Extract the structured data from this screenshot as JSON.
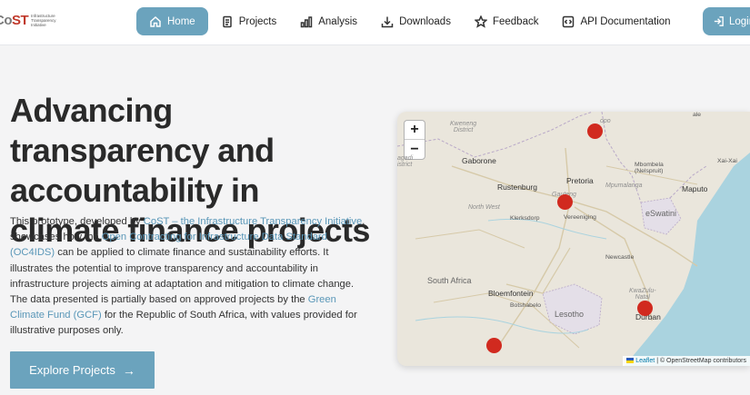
{
  "header": {
    "logo": {
      "main_prefix": "Co",
      "main_accent": "ST",
      "tagline": "Infrastructure Transparency Initiative"
    },
    "nav": [
      {
        "label": "Home",
        "icon": "home-icon",
        "active": true
      },
      {
        "label": "Projects",
        "icon": "document-icon",
        "active": false
      },
      {
        "label": "Analysis",
        "icon": "bar-chart-icon",
        "active": false
      },
      {
        "label": "Downloads",
        "icon": "download-icon",
        "active": false
      },
      {
        "label": "Feedback",
        "icon": "star-icon",
        "active": false
      },
      {
        "label": "API Documentation",
        "icon": "code-icon",
        "active": false
      }
    ],
    "login_label": "Login"
  },
  "hero": {
    "title": "Advancing transparency and accountability in climate finance projects",
    "desc": {
      "p1": "This prototype, developed by ",
      "link1": "CoST – the Infrastructure Transparency Initiative",
      "p2": ", showcases how the ",
      "link2": "Open Contracting for Infrastructure Data Standard (OC4IDS)",
      "p3": " can be applied to climate finance and sustainability efforts. It illustrates the potential to improve transparency and accountability in infrastructure projects aiming at adaptation and mitigation to climate change. The data presented is partially based on approved projects by the ",
      "link3": "Green Climate Fund (GCF)",
      "p4": " for the Republic of South Africa, with values provided for illustrative purposes only."
    },
    "cta_label": "Explore Projects",
    "cta_arrow": "→"
  },
  "map": {
    "zoom_in": "+",
    "zoom_out": "−",
    "places": {
      "kweneng": "Kweneng\nDistrict",
      "gaborone": "Gaborone",
      "pretoria": "Pretoria",
      "rustenburg": "Rustenburg",
      "gauteng": "Gauteng",
      "vereeniging": "Vereeniging",
      "klerksdorp": "Klerksdorp",
      "northwest": "North West",
      "mpumalanga": "Mpumalanga",
      "mbombela": "Mbombela\n(Nelspruit)",
      "maputo": "Maputo",
      "xaixai": "Xai-Xai",
      "eswatini": "eSwatini",
      "newcastle": "Newcastle",
      "southafrica": "South Africa",
      "bloemfontein": "Bloemfontein",
      "botshabelo": "Botshabelo",
      "lesotho": "Lesotho",
      "kwazulu": "KwaZulu-\nNatal",
      "durban": "Durban",
      "agadi": "agadi\nistrict",
      "polokwane": "opo",
      "scale": "ale"
    },
    "attribution_link": "Leaflet",
    "attribution_text": " | © OpenStreetMap contributors"
  }
}
